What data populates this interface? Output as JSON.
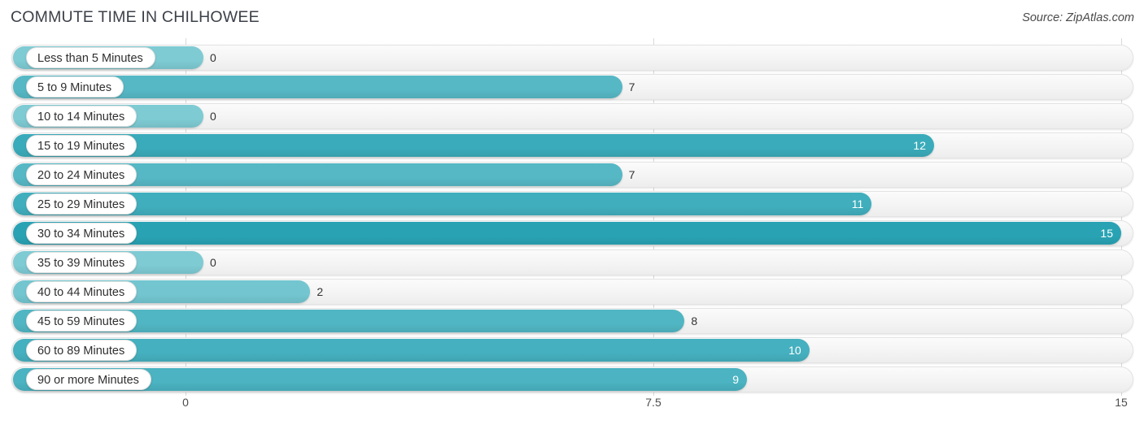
{
  "header": {
    "title": "COMMUTE TIME IN CHILHOWEE",
    "source": "Source: ZipAtlas.com"
  },
  "colors": {
    "bar_low": "#7ECBD4",
    "bar_high": "#29A3B4",
    "track": "#f4f4f4",
    "gridline": "#d9d9d9",
    "value_inside": "#ffffff",
    "value_outside": "#333333"
  },
  "axis": {
    "ticks": [
      "0",
      "7.5",
      "15"
    ],
    "min": 0,
    "max": 15
  },
  "chart_data": {
    "type": "bar",
    "orientation": "horizontal",
    "title": "COMMUTE TIME IN CHILHOWEE",
    "subtitle": "Source: ZipAtlas.com",
    "xlabel": "",
    "ylabel": "",
    "xlim": [
      0,
      15
    ],
    "xticks": [
      0,
      7.5,
      15
    ],
    "grid": true,
    "legend": "none",
    "categories": [
      "Less than 5 Minutes",
      "5 to 9 Minutes",
      "10 to 14 Minutes",
      "15 to 19 Minutes",
      "20 to 24 Minutes",
      "25 to 29 Minutes",
      "30 to 34 Minutes",
      "35 to 39 Minutes",
      "40 to 44 Minutes",
      "45 to 59 Minutes",
      "60 to 89 Minutes",
      "90 or more Minutes"
    ],
    "values": [
      0,
      7,
      0,
      12,
      7,
      11,
      15,
      0,
      2,
      8,
      10,
      9
    ],
    "value_labels": [
      "0",
      "7",
      "0",
      "12",
      "7",
      "11",
      "15",
      "0",
      "2",
      "8",
      "10",
      "9"
    ]
  }
}
